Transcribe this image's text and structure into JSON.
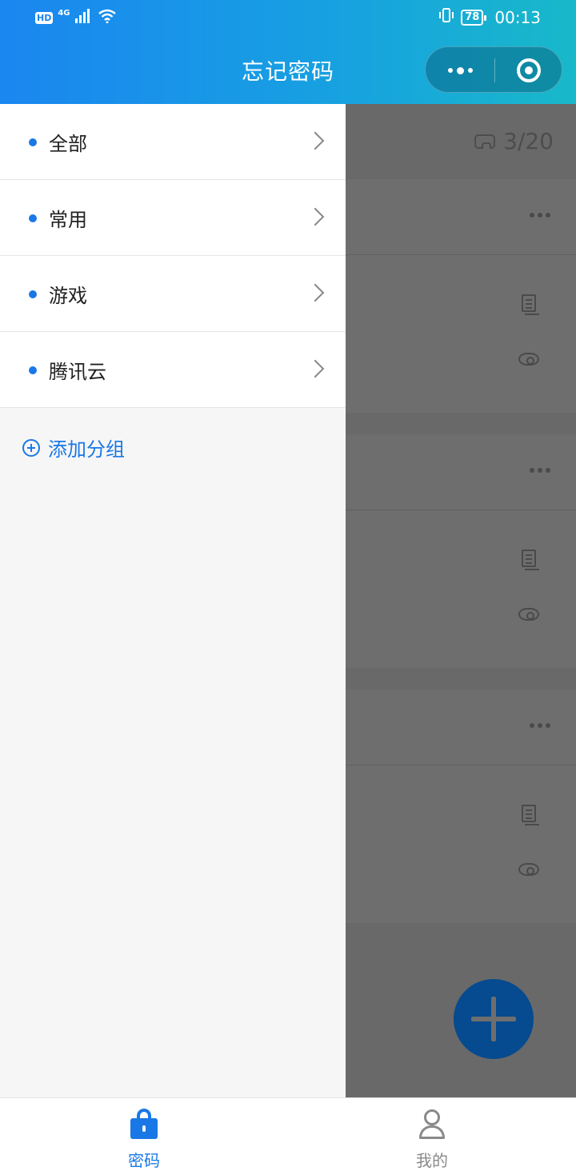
{
  "status_bar": {
    "hd": "HD",
    "network": "4G",
    "battery": "78",
    "time": "00:13"
  },
  "nav": {
    "title": "忘记密码"
  },
  "background": {
    "quota": "3/20"
  },
  "drawer": {
    "groups": [
      {
        "label": "全部"
      },
      {
        "label": "常用"
      },
      {
        "label": "游戏"
      },
      {
        "label": "腾讯云"
      }
    ],
    "add_group_label": "添加分组"
  },
  "tabbar": {
    "tabs": [
      {
        "label": "密码",
        "icon": "lock-icon",
        "active": true
      },
      {
        "label": "我的",
        "icon": "person-icon",
        "active": false
      }
    ]
  },
  "colors": {
    "accent": "#1a78e6",
    "header_start": "#1a86f0",
    "header_end": "#18b9c9",
    "overlay": "#696969"
  }
}
